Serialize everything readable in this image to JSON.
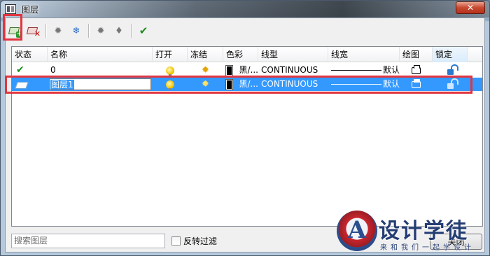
{
  "window": {
    "title": "图层",
    "close_symbol": "✕"
  },
  "toolbar": {
    "new_layer_plus": "+",
    "delete_layer_x": "✕",
    "freeze_symbol": "✹",
    "thaw_symbol": "❄",
    "on_symbol": "✹",
    "bulb_symbol": "♦",
    "apply_symbol": "✔"
  },
  "columns": [
    "状态",
    "名称",
    "打开",
    "冻结",
    "色彩",
    "线型",
    "线宽",
    "绘图",
    "锁定"
  ],
  "layers": [
    {
      "status_icon": "check-icon",
      "status_symbol": "✔",
      "name": "0",
      "on": true,
      "frozen": false,
      "color_label": "黑/...",
      "color_hex": "#000000",
      "linetype": "CONTINUOUS",
      "lineweight": "默认",
      "plot": true,
      "locked": false,
      "selected": false
    },
    {
      "status_icon": "layer-icon",
      "status_symbol": "",
      "name": "图层1",
      "on": true,
      "frozen": false,
      "color_label": "黑/...",
      "color_hex": "#000000",
      "linetype": "CONTINUOUS",
      "lineweight": "默认",
      "plot": true,
      "locked": false,
      "selected": true
    }
  ],
  "search": {
    "placeholder": "搜索图层"
  },
  "reverse_filter": {
    "label": "反转过滤",
    "checked": false
  },
  "close_button": {
    "label": "关闭"
  },
  "watermark": {
    "title": "设计学徒",
    "subtitle": "来和我们一起学设计"
  },
  "colors": {
    "selection": "#3399ff",
    "highlight_box": "#e0353f",
    "ok_green": "#1e8a1e"
  }
}
